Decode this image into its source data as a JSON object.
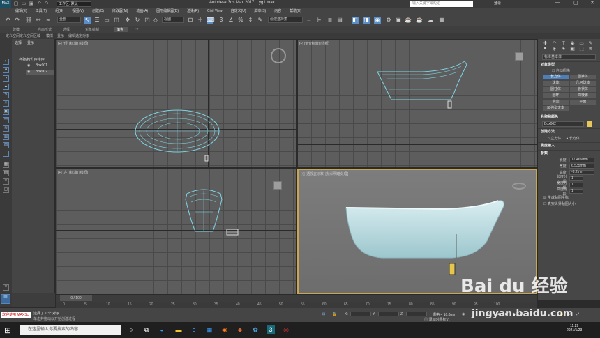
{
  "titlebar": {
    "workspace": "工作区: 默认",
    "title": "Autodesk 3ds Max 2017",
    "filename": "yg1.max",
    "search_placeholder": "输入关键字或短语",
    "login": "登录"
  },
  "menu": [
    "编辑(E)",
    "工具(T)",
    "组(G)",
    "视图(V)",
    "创建(C)",
    "修改器(M)",
    "动画(A)",
    "图形编辑器(D)",
    "渲染(R)",
    "Civil View",
    "自定义(U)",
    "脚本(S)",
    "内容",
    "帮助(H)"
  ],
  "toolbar": {
    "filter": "全部",
    "ref_coord": "视图",
    "selection_set": "创建选择集"
  },
  "ribbon": {
    "tabs": [
      "建模",
      "自由形式",
      "选择",
      "对象绘制",
      "填充"
    ],
    "active": "填充"
  },
  "ribbon2": {
    "items": [
      "定义空间",
      "定义空间区域",
      "模拟",
      "显示",
      "编辑选定对象"
    ]
  },
  "scene": {
    "tabs": [
      "选择",
      "显示"
    ],
    "header": "名称(按升序排序)",
    "items": [
      "Box001",
      "Box002"
    ]
  },
  "viewports": {
    "top": "[+] [顶] [标准] [线框]",
    "front": "[+] [前] [标准] [线框]",
    "left": "[+] [左] [标准] [线框]",
    "persp": "[+] [透视] [标准] [默认明暗处理]"
  },
  "command_panel": {
    "category": "标准基本体",
    "object_type_title": "对象类型",
    "autogrid": "自动栅格",
    "buttons": [
      "长方体",
      "圆锥体",
      "球体",
      "几何球体",
      "圆柱体",
      "管状体",
      "圆环",
      "四棱锥",
      "茶壶",
      "平面",
      "加强型文本"
    ],
    "active_button": "长方体",
    "name_color_title": "名称和颜色",
    "object_name": "Box002",
    "create_method_title": "创建方法",
    "methods": [
      "立方体",
      "长方体"
    ],
    "keyboard_title": "键盘输入",
    "params_title": "参数",
    "params": [
      {
        "label": "长度:",
        "value": "17.466mm"
      },
      {
        "label": "宽度:",
        "value": "6.535mm"
      },
      {
        "label": "高度:",
        "value": "-6.2mm"
      },
      {
        "label": "长度分段:",
        "value": "1"
      },
      {
        "label": "宽度分段:",
        "value": "1"
      },
      {
        "label": "高度分段:",
        "value": "1"
      }
    ],
    "checks": [
      "生成贴图坐标",
      "真实世界贴图大小"
    ]
  },
  "timeline": {
    "slider": "0 / 100",
    "ticks": [
      "0",
      "5",
      "10",
      "15",
      "20",
      "25",
      "30",
      "35",
      "40",
      "45",
      "50",
      "55",
      "60",
      "65",
      "70",
      "75",
      "80",
      "85",
      "90",
      "95",
      "100"
    ]
  },
  "status": {
    "welcome": "欢迎使用 MAXScr",
    "selected": "选择了 1 个 对象",
    "hint": "单击并拖动以开始创建过程",
    "x_label": "X:",
    "y_label": "Y:",
    "z_label": "Z:",
    "grid": "栅格 = 10.0mm",
    "add_time_tag": "添加时间标记"
  },
  "taskbar": {
    "search_placeholder": "在这里输入你要搜索的内容",
    "time": "11:29",
    "date": "2021/1/23"
  },
  "watermark": {
    "logo": "Bai du 经验",
    "url": "jingyan.baidu.com"
  },
  "colors": {
    "accent": "#4d7eb8",
    "wireframe": "#7fd6e6",
    "tub": "#bfe0e6",
    "active_border": "#c9a64f"
  }
}
